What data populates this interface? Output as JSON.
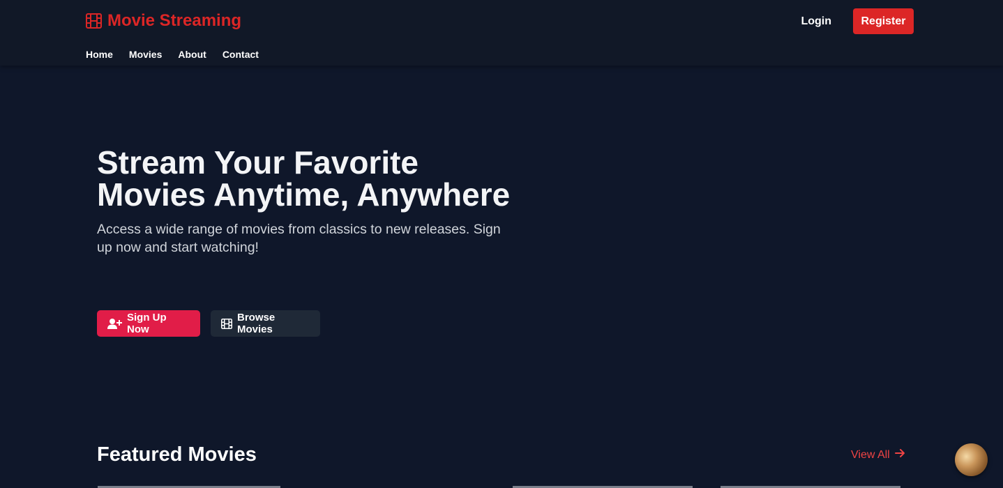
{
  "brand": {
    "name": "Movie Streaming",
    "icon": "film-icon",
    "color": "#dc2626"
  },
  "nav": {
    "items": [
      {
        "label": "Home"
      },
      {
        "label": "Movies"
      },
      {
        "label": "About"
      },
      {
        "label": "Contact"
      }
    ]
  },
  "auth": {
    "login_label": "Login",
    "register_label": "Register"
  },
  "hero": {
    "title": "Stream Your Favorite Movies Anytime, Anywhere",
    "subtitle": "Access a wide range of movies from classics to new releases. Sign up now and start watching!",
    "primary_button": {
      "label": "Sign Up Now",
      "icon": "user-plus-icon"
    },
    "secondary_button": {
      "label": "Browse Movies",
      "icon": "film-icon"
    }
  },
  "featured": {
    "title": "Featured Movies",
    "view_all_label": "View All",
    "view_all_icon": "arrow-right-icon"
  },
  "colors": {
    "background": "#0f172a",
    "header": "#111827",
    "accent": "#dc2626",
    "primary_button": "#e11d48",
    "secondary_button": "#1f2937"
  }
}
